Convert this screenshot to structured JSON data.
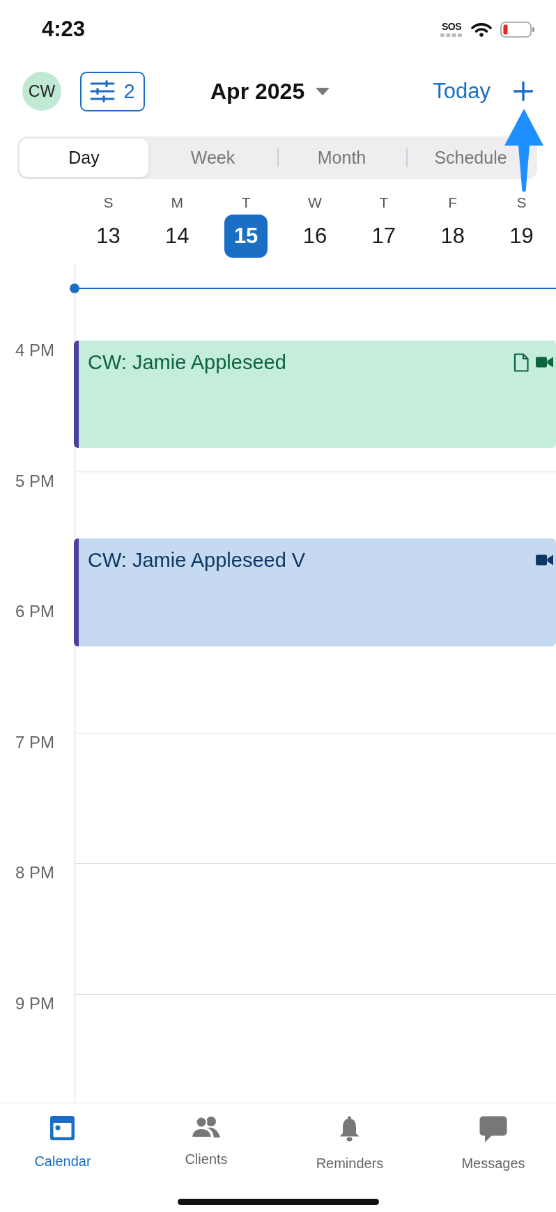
{
  "status_bar": {
    "time": "4:23",
    "sos": "SOS"
  },
  "header": {
    "avatar": {
      "initials": "CW"
    },
    "filter": {
      "count": "2"
    },
    "title": "Apr 2025",
    "today": "Today"
  },
  "view_tabs": [
    {
      "label": "Day",
      "selected": true
    },
    {
      "label": "Week",
      "selected": false
    },
    {
      "label": "Month",
      "selected": false
    },
    {
      "label": "Schedule",
      "selected": false
    }
  ],
  "week": [
    {
      "weekday": "S",
      "date": "13",
      "selected": false
    },
    {
      "weekday": "M",
      "date": "14",
      "selected": false
    },
    {
      "weekday": "T",
      "date": "15",
      "selected": true
    },
    {
      "weekday": "W",
      "date": "16",
      "selected": false
    },
    {
      "weekday": "T",
      "date": "17",
      "selected": false
    },
    {
      "weekday": "F",
      "date": "18",
      "selected": false
    },
    {
      "weekday": "S",
      "date": "19",
      "selected": false
    }
  ],
  "hours": [
    "4 PM",
    "5 PM",
    "6 PM",
    "7 PM",
    "8 PM",
    "9 PM"
  ],
  "events": [
    {
      "title": "CW: Jamie Appleseed",
      "color": "#c5eddb",
      "note": true,
      "video": true
    },
    {
      "title": "CW: Jamie Appleseed V",
      "color": "#c5daf0",
      "note": false,
      "video": true
    }
  ],
  "bottom_tabs": [
    {
      "label": "Calendar",
      "selected": true
    },
    {
      "label": "Clients",
      "selected": false
    },
    {
      "label": "Reminders",
      "selected": false
    },
    {
      "label": "Messages",
      "selected": false
    }
  ]
}
